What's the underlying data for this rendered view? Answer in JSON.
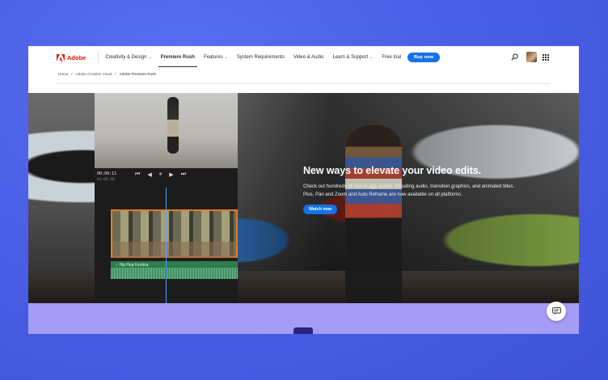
{
  "header": {
    "brand": "Adobe",
    "nav": [
      {
        "label": "Creativity & Design",
        "caret": true,
        "active": false
      },
      {
        "label": "Premiere Rush",
        "caret": false,
        "active": true
      },
      {
        "label": "Features",
        "caret": true,
        "active": false
      },
      {
        "label": "System Requirements",
        "caret": false,
        "active": false
      },
      {
        "label": "Video & Audio",
        "caret": false,
        "active": false
      },
      {
        "label": "Learn & Support",
        "caret": true,
        "active": false
      },
      {
        "label": "Free trial",
        "caret": false,
        "active": false
      }
    ],
    "buy_label": "Buy now",
    "icons": [
      "search-icon",
      "avatar",
      "apps-grid-icon"
    ]
  },
  "breadcrumb": [
    "Home",
    "Adobe Creative Cloud",
    "Adobe Premiere Rush"
  ],
  "editor": {
    "timecode": "00:00:11",
    "timecode_secondary": "01:05:48",
    "audio_track_label": "Hip Hop Exotica",
    "controls": [
      "skip-back-icon",
      "step-back-icon",
      "pause-icon",
      "step-forward-icon",
      "skip-forward-icon"
    ]
  },
  "hero": {
    "title": "New ways to elevate your video edits.",
    "body": "Check out hundreds of new in-app assets, including audio, transition graphics, and animated titles. Plus, Pan and Zoom and Auto Reframe are now available on all platforms.",
    "cta_label": "Watch now"
  },
  "colors": {
    "background": "#4a5fe6",
    "brand_red": "#eb1000",
    "accent_blue": "#1473e6",
    "band_purple": "#a49cf5"
  }
}
